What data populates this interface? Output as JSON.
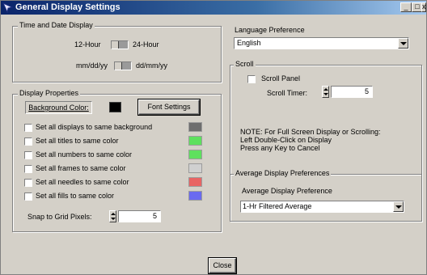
{
  "window": {
    "title": "General Display Settings",
    "app_icon": "settings-app-icon",
    "controls": {
      "minimize": "_",
      "maximize": "□",
      "close": "x"
    }
  },
  "time_date": {
    "group_label": "Time and Date Display",
    "clock_left": "12-Hour",
    "clock_right": "24-Hour",
    "date_left": "mm/dd/yy",
    "date_right": "dd/mm/yy"
  },
  "display_properties": {
    "group_label": "Display Properties",
    "background_color_label": "Background Color:",
    "background_color": "#000000",
    "font_settings_label": "Font Settings",
    "options": [
      {
        "label": "Set all displays to same background",
        "color": "#6e6e6e"
      },
      {
        "label": "Set all titles to same color",
        "color": "#5ee05e"
      },
      {
        "label": "Set all numbers to same color",
        "color": "#5ee05e"
      },
      {
        "label": "Set all frames to same color",
        "color": "#d0d0d0"
      },
      {
        "label": "Set all needles to same color",
        "color": "#e86464"
      },
      {
        "label": "Set all fills to same color",
        "color": "#6a6af0"
      }
    ],
    "snap_label": "Snap to Grid Pixels:",
    "snap_value": "5"
  },
  "language": {
    "label": "Language Preference",
    "selected": "English"
  },
  "scroll": {
    "group_label": "Scroll",
    "panel_label": "Scroll Panel",
    "timer_label": "Scroll Timer:",
    "timer_value": "5",
    "note_line1": "NOTE: For Full Screen Display or Scrolling:",
    "note_line2": "Left Double-Click on Display",
    "note_line3": "Press any Key to Cancel"
  },
  "average": {
    "group_label": "Average Display Preferences",
    "label": "Average Display Preference",
    "selected": "1-Hr Filtered Average"
  },
  "close_label": "Close"
}
